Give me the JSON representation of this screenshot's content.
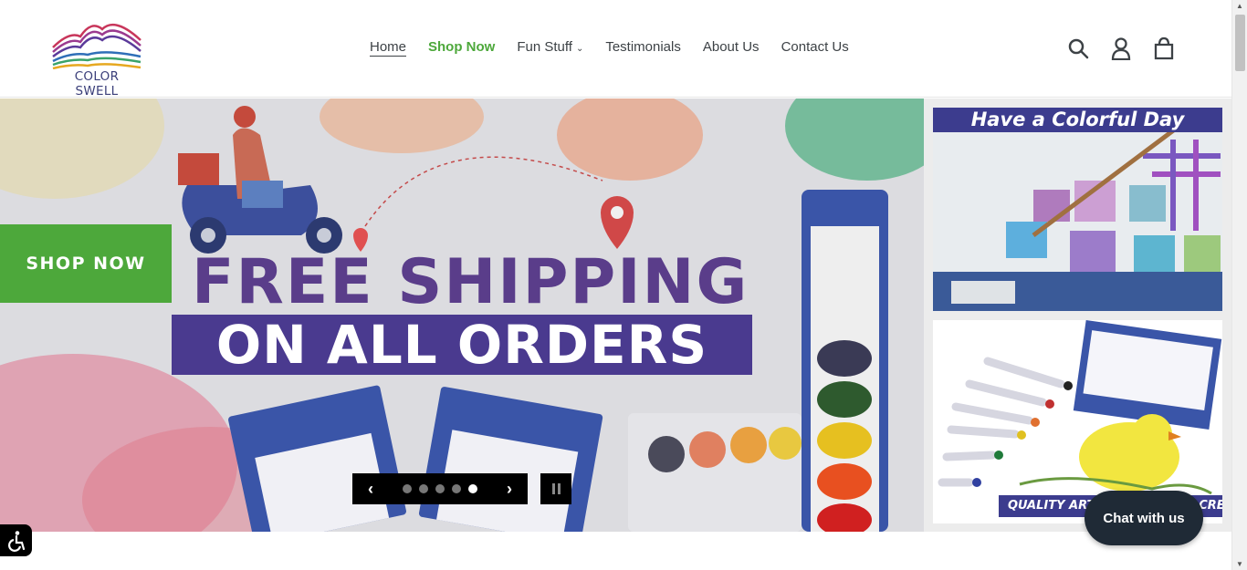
{
  "brand": {
    "name": "COLOR SWELL"
  },
  "nav": {
    "items": [
      {
        "label": "Home"
      },
      {
        "label": "Shop Now"
      },
      {
        "label": "Fun Stuff"
      },
      {
        "label": "Testimonials"
      },
      {
        "label": "About Us"
      },
      {
        "label": "Contact Us"
      }
    ]
  },
  "header_icons": [
    "search-icon",
    "account-icon",
    "cart-icon"
  ],
  "hero": {
    "cta_label": "SHOP NOW",
    "headline_1": "FREE SHIPPING",
    "headline_2": "ON ALL ORDERS",
    "slides_total": 5,
    "active_slide": 5
  },
  "side_tiles": {
    "tile1_caption": "Have a Colorful Day",
    "tile2_caption": "QUALITY ART SUPPLIES FOR CREAT"
  },
  "chat": {
    "label": "Chat with us"
  },
  "colors": {
    "accent_green": "#4da83b",
    "brand_purple": "#3c3c8e",
    "chat_dark": "#1f2a36"
  }
}
